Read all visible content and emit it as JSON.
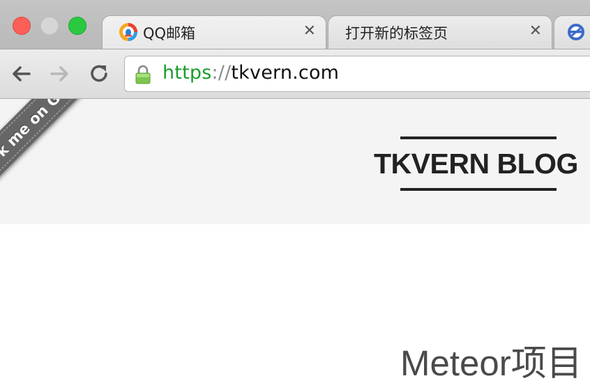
{
  "tabs": [
    {
      "title": "QQ邮箱",
      "icon": "qq-mail-icon",
      "active": true
    },
    {
      "title": "打开新的标签页",
      "icon": "",
      "active": false
    },
    {
      "title": "",
      "icon": "ie-icon",
      "active": false
    }
  ],
  "omnibox": {
    "scheme": "https",
    "separator": "://",
    "host": "tkvern.com"
  },
  "page": {
    "ribbon": "Fork me on GitHub",
    "brand": "TKVERN BLOG",
    "post_title": "Meteor项目"
  },
  "colors": {
    "secure_green": "#1a9d2a",
    "ribbon_bg": "#666666",
    "hero_bg": "#f4f4f4"
  }
}
